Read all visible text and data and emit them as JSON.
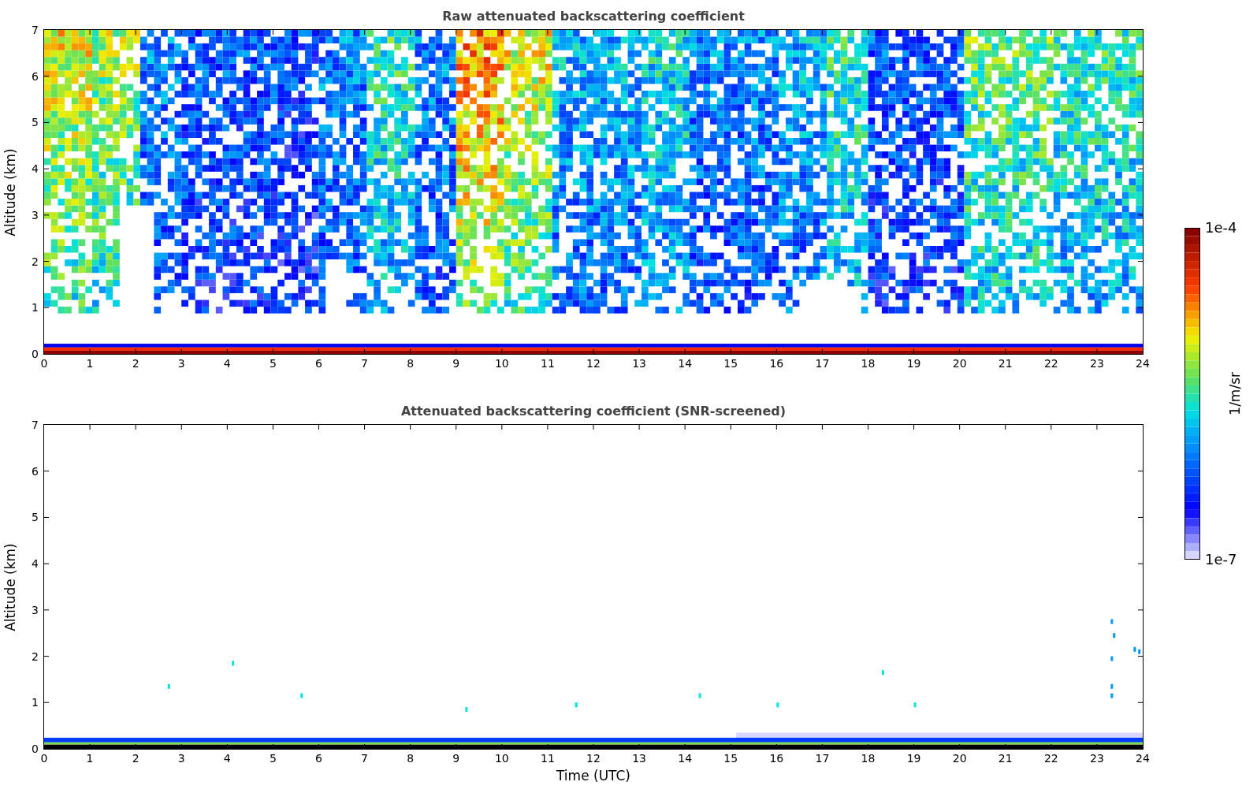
{
  "panels": [
    {
      "kind": "raw",
      "title": "Raw attenuated backscattering coefficient",
      "ylabel": "Altitude (km)",
      "yticks": [
        "7",
        "6",
        "5",
        "4",
        "3",
        "2",
        "1",
        "0"
      ],
      "xticks": [
        "0",
        "1",
        "2",
        "3",
        "4",
        "5",
        "6",
        "7",
        "8",
        "9",
        "10",
        "11",
        "12",
        "13",
        "14",
        "15",
        "16",
        "17",
        "18",
        "19",
        "20",
        "21",
        "22",
        "23",
        "24"
      ]
    },
    {
      "kind": "screened",
      "title": "Attenuated backscattering coefficient (SNR-screened)",
      "ylabel": "Altitude (km)",
      "yticks": [
        "7",
        "6",
        "5",
        "4",
        "3",
        "2",
        "1",
        "0"
      ],
      "xticks": [
        "0",
        "1",
        "2",
        "3",
        "4",
        "5",
        "6",
        "7",
        "8",
        "9",
        "10",
        "11",
        "12",
        "13",
        "14",
        "15",
        "16",
        "17",
        "18",
        "19",
        "20",
        "21",
        "22",
        "23",
        "24"
      ],
      "xlabel": "Time (UTC)"
    }
  ],
  "colorbar": {
    "label": "1/m/sr",
    "max_label": "1e-4",
    "min_label": "1e-7"
  }
}
